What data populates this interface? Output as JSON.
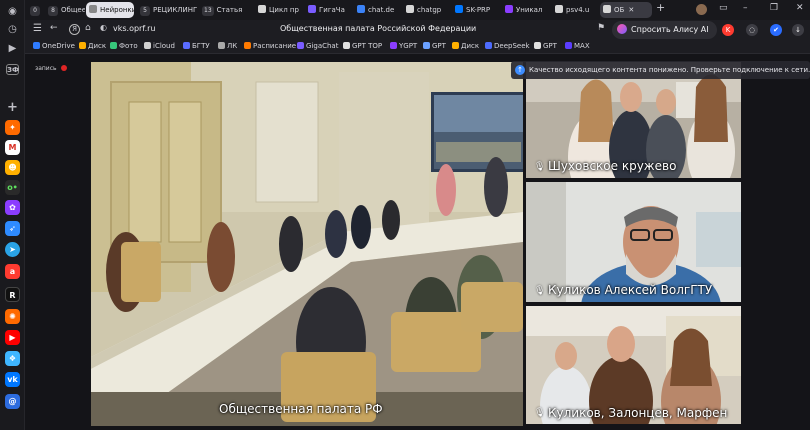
{
  "browser": {
    "tabs": [
      {
        "count": "0",
        "label": ""
      },
      {
        "count": "8",
        "label": "Общее"
      },
      {
        "count": "",
        "label": "Нейронки"
      },
      {
        "count": "5",
        "label": "РЕЦИКЛИНГ"
      },
      {
        "count": "13",
        "label": "Статья"
      },
      {
        "count": "",
        "label": "Цикл пр"
      },
      {
        "count": "",
        "label": "ГигаЧа"
      },
      {
        "count": "",
        "label": "chat.de"
      },
      {
        "count": "",
        "label": "chatgp"
      },
      {
        "count": "",
        "label": "SK-PRP"
      },
      {
        "count": "",
        "label": "Уникал"
      },
      {
        "count": "",
        "label": "psv4.u"
      },
      {
        "count": "",
        "label": "ОБ"
      }
    ],
    "url": "vks.oprf.ru",
    "page_title": "Общественная палата Российской Федерации",
    "alice_label": "Спросить Алису AI",
    "bookmarks": [
      "OneDrive",
      "Диск",
      "Фото",
      "iCloud",
      "БГТУ",
      "ЛК",
      "Расписание",
      "GigaChat",
      "GPT TOP",
      "YGPT",
      "GPT",
      "Диск",
      "DeepSeek",
      "GPT",
      "MAX"
    ]
  },
  "rail_icons": [
    "logo-icon",
    "history-icon",
    "play-icon",
    "media-icon",
    "add-icon",
    "app-icon",
    "gmail-icon",
    "app-icon",
    "app-icon",
    "app-icon",
    "app-icon",
    "telegram-icon",
    "app-icon",
    "app-icon",
    "app-icon",
    "youtube-icon",
    "app-icon",
    "vk-icon",
    "app-icon"
  ],
  "conference": {
    "record_label": "запись",
    "notice": "Качество исходящего контента понижено. Проверьте подключение к сети.",
    "main_label": "Общественная палата РФ",
    "participants": [
      {
        "name": "Шуховское кружево"
      },
      {
        "name": "Куликов Алексей ВолгГТУ"
      },
      {
        "name": "Куликов, Залонцев, Марфен"
      }
    ]
  }
}
